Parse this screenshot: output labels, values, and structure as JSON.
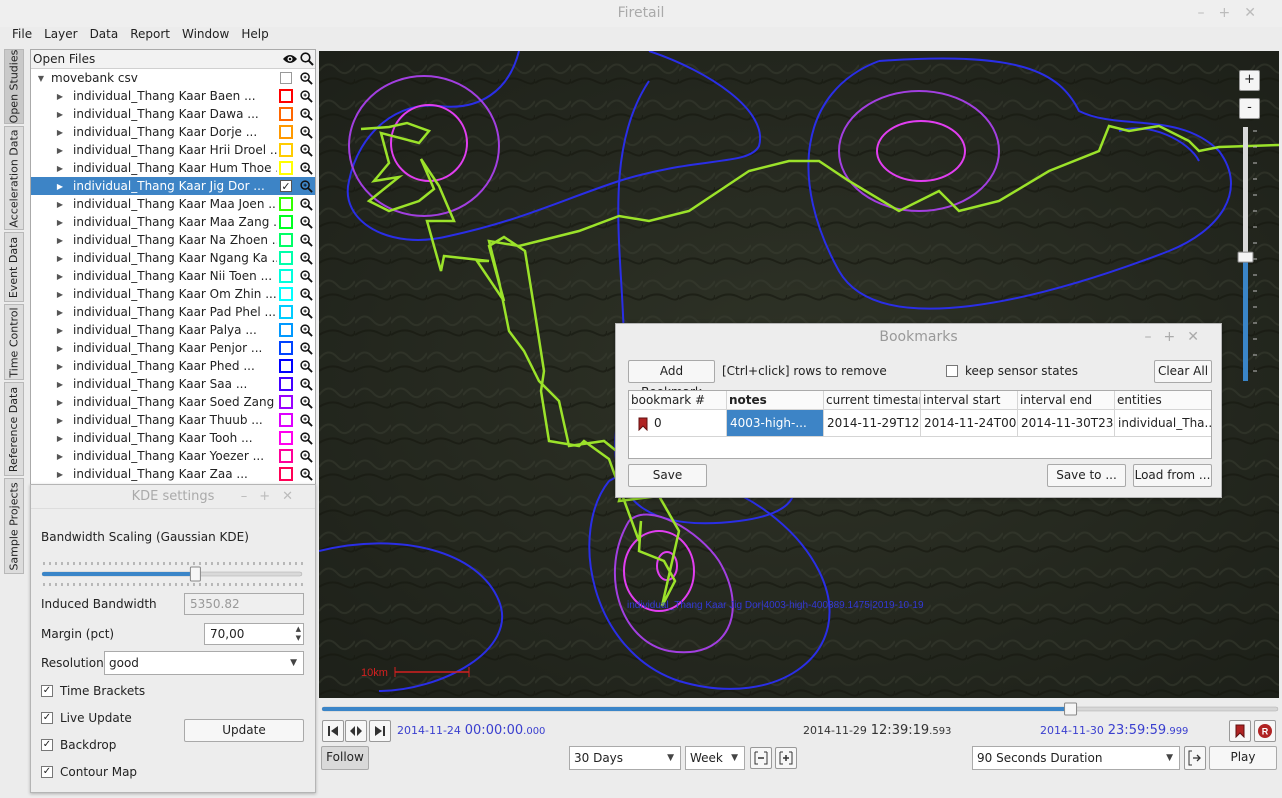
{
  "app": {
    "title": "Firetail"
  },
  "menu": [
    "File",
    "Layer",
    "Data",
    "Report",
    "Window",
    "Help"
  ],
  "side_tabs": [
    "Open Studies",
    "Acceleration Data",
    "Event Data",
    "Time Control",
    "Reference Data",
    "Sample Projects"
  ],
  "studies": {
    "header": "Open Files",
    "root": "movebank csv",
    "items": [
      {
        "label": "individual_Thang Kaar Baen ...",
        "color": "#ff0000",
        "checked": false
      },
      {
        "label": "individual_Thang Kaar Dawa ...",
        "color": "#ff6600",
        "checked": false
      },
      {
        "label": "individual_Thang Kaar Dorje ...",
        "color": "#ff9900",
        "checked": false
      },
      {
        "label": "individual_Thang Kaar Hrii Droel ...",
        "color": "#ffcc00",
        "checked": false
      },
      {
        "label": "individual_Thang Kaar Hum Thoe ...",
        "color": "#ffff00",
        "checked": false
      },
      {
        "label": "individual_Thang Kaar Jig Dor ...",
        "color": "#99ff00",
        "checked": true
      },
      {
        "label": "individual_Thang Kaar Maa Joen ...",
        "color": "#33ff00",
        "checked": false
      },
      {
        "label": "individual_Thang Kaar Maa Zang ...",
        "color": "#00ff22",
        "checked": false
      },
      {
        "label": "individual_Thang Kaar Na Zhoen ...",
        "color": "#00ff66",
        "checked": false
      },
      {
        "label": "individual_Thang Kaar Ngang Ka ...",
        "color": "#00ffaa",
        "checked": false
      },
      {
        "label": "individual_Thang Kaar Nii Toen ...",
        "color": "#00ffdd",
        "checked": false
      },
      {
        "label": "individual_Thang Kaar Om Zhin ...",
        "color": "#00ffff",
        "checked": false
      },
      {
        "label": "individual_Thang Kaar Pad Phel ...",
        "color": "#00ccff",
        "checked": false
      },
      {
        "label": "individual_Thang Kaar Palya ...",
        "color": "#0099ff",
        "checked": false
      },
      {
        "label": "individual_Thang Kaar Penjor ...",
        "color": "#0044ff",
        "checked": false
      },
      {
        "label": "individual_Thang Kaar Phed ...",
        "color": "#0000ff",
        "checked": false
      },
      {
        "label": "individual_Thang Kaar Saa ...",
        "color": "#4400ff",
        "checked": false
      },
      {
        "label": "individual_Thang Kaar Soed Zang ...",
        "color": "#9900ff",
        "checked": false
      },
      {
        "label": "individual_Thang Kaar Thuub ...",
        "color": "#dd00ff",
        "checked": false
      },
      {
        "label": "individual_Thang Kaar Tooh ...",
        "color": "#ff00ee",
        "checked": false
      },
      {
        "label": "individual_Thang Kaar Yoezer ...",
        "color": "#ff0099",
        "checked": false
      },
      {
        "label": "individual_Thang Kaar Zaa ...",
        "color": "#ff0055",
        "checked": false
      }
    ]
  },
  "kde": {
    "title": "KDE settings",
    "bandwidth_label": "Bandwidth Scaling (Gaussian KDE)",
    "slider_value": 0.59,
    "induced_label": "Induced Bandwidth",
    "induced_value": "5350.82",
    "margin_label": "Margin (pct)",
    "margin_value": "70,00",
    "resolution_label": "Resolution",
    "resolution_value": "good",
    "time_brackets": "Time Brackets",
    "live_update": "Live Update",
    "backdrop": "Backdrop",
    "contour_map": "Contour Map",
    "update_button": "Update"
  },
  "map": {
    "zoom_in": "+",
    "zoom_out": "-",
    "scale_label": "10km",
    "track_label": "individual_Thang Kaar Jig Dor|4003-high-400389.1475|2019-10-19",
    "zoom_level": 0.35
  },
  "bookmarks": {
    "title": "Bookmarks",
    "add_button": "Add Bookmark",
    "hint": "[Ctrl+click] rows to remove",
    "keep_label": "keep sensor states",
    "clear_button": "Clear All",
    "columns": [
      "bookmark #",
      "notes",
      "current timestamp",
      "interval start",
      "interval end",
      "entities"
    ],
    "rows": [
      {
        "num": "0",
        "notes": "4003-high-...",
        "current": "2014-11-29T12...",
        "start": "2014-11-24T00...",
        "end": "2014-11-30T23...",
        "entities": "individual_Tha..."
      }
    ],
    "save_button": "Save",
    "save_to_button": "Save to ...",
    "load_button": "Load from ..."
  },
  "time": {
    "progress": 0.783,
    "start_date": "2014-11-24",
    "start_time": "00:00:00",
    "start_ms": ".000",
    "cur_date": "2014-11-29",
    "cur_time": "12:39:19",
    "cur_ms": ".593",
    "end_date": "2014-11-30",
    "end_time": "23:59:59",
    "end_ms": ".999",
    "follow_button": "Follow",
    "window_select": "30 Days",
    "step_select": "Week",
    "duration_select": "90 Seconds Duration",
    "play_button": "Play"
  }
}
